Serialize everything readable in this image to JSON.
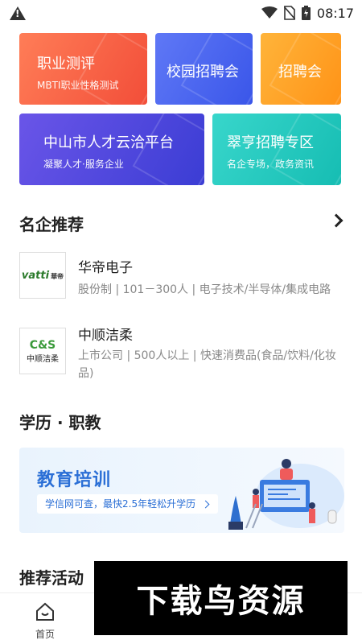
{
  "status_bar": {
    "time": "08:17"
  },
  "tiles": [
    {
      "title": "职业测评",
      "subtitle": "MBTI职业性格测试",
      "color_from": "#ff7a55",
      "color_to": "#f4513a"
    },
    {
      "title": "校园招聘会",
      "subtitle": "",
      "color_from": "#5b72f5",
      "color_to": "#3a57ea"
    },
    {
      "title": "招聘会",
      "subtitle": "",
      "color_from": "#ffb238",
      "color_to": "#ff9417"
    },
    {
      "title": "中山市人才云洽平台",
      "subtitle": "凝聚人才·服务企业",
      "color_from": "#6653e6",
      "color_to": "#3f3fd6"
    },
    {
      "title": "翠亨招聘专区",
      "subtitle": "名企专场，政务资讯",
      "color_from": "#33d3c8",
      "color_to": "#18bfb5"
    }
  ],
  "famous": {
    "title": "名企推荐",
    "companies": [
      {
        "name": "华帝电子",
        "meta": "股份制 | 101－300人 | 电子技术/半导体/集成电路",
        "logo_line1": "vatti",
        "logo_line2": "華帝"
      },
      {
        "name": "中顺洁柔",
        "meta": "上市公司 | 500人以上 | 快速消费品(食品/饮料/化妆品)",
        "logo_line1": "C&S",
        "logo_line2": "中顺洁柔"
      }
    ]
  },
  "education": {
    "title": "学历 · 职教",
    "banner_title": "教育培训",
    "banner_sub": "学信网可查，最快2.5年轻松升学历"
  },
  "activities": {
    "title": "推荐活动"
  },
  "nav": {
    "home": "首页"
  },
  "watermark": "下载鸟资源"
}
